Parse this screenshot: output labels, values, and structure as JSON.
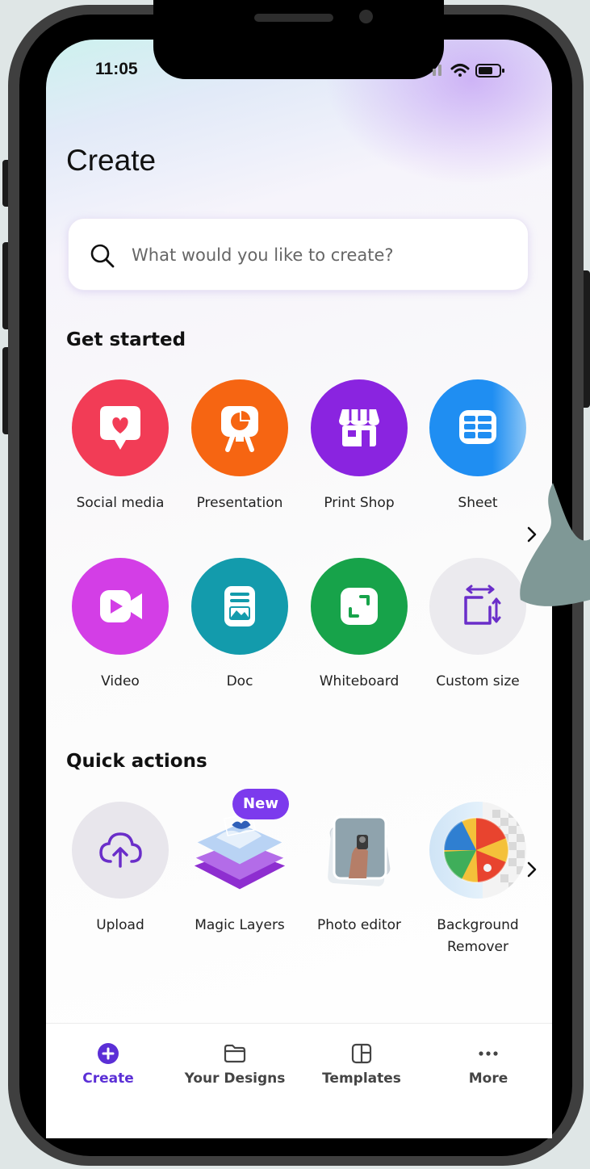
{
  "status_bar": {
    "time": "11:05"
  },
  "header": {
    "title": "Create"
  },
  "search": {
    "placeholder": "What would you like to create?"
  },
  "sections": {
    "get_started": {
      "title": "Get started",
      "items": [
        {
          "label": "Social media",
          "icon": "heart-speech-icon",
          "color": "#f23c56"
        },
        {
          "label": "Presentation",
          "icon": "presentation-chart-icon",
          "color": "#f66512"
        },
        {
          "label": "Print Shop",
          "icon": "storefront-icon",
          "color": "#8a24e0"
        },
        {
          "label": "Sheet",
          "icon": "grid-sheet-icon",
          "color": "#1f8ef2"
        },
        {
          "label": "Video",
          "icon": "video-camera-icon",
          "color": "#d33ee6"
        },
        {
          "label": "Doc",
          "icon": "document-icon",
          "color": "#139bac"
        },
        {
          "label": "Whiteboard",
          "icon": "expand-frame-icon",
          "color": "#17a34a"
        },
        {
          "label": "Custom size",
          "icon": "resize-icon",
          "color": "#ebeaee"
        }
      ]
    },
    "quick_actions": {
      "title": "Quick actions",
      "badge": "New",
      "items": [
        {
          "label": "Upload",
          "icon": "cloud-upload-icon"
        },
        {
          "label": "Magic Layers",
          "icon": "magic-layers-icon"
        },
        {
          "label": "Photo editor",
          "icon": "photo-editor-icon"
        },
        {
          "label": "Background",
          "label2": "Remover",
          "icon": "background-remover-icon"
        }
      ]
    }
  },
  "bottom_nav": [
    {
      "label": "Create",
      "icon": "plus-circle-icon",
      "active": true
    },
    {
      "label": "Your Designs",
      "icon": "folder-icon"
    },
    {
      "label": "Templates",
      "icon": "templates-icon"
    },
    {
      "label": "More",
      "icon": "more-dots-icon"
    }
  ],
  "colors": {
    "accent": "#5b2fd6",
    "badge": "#7c3aed"
  }
}
